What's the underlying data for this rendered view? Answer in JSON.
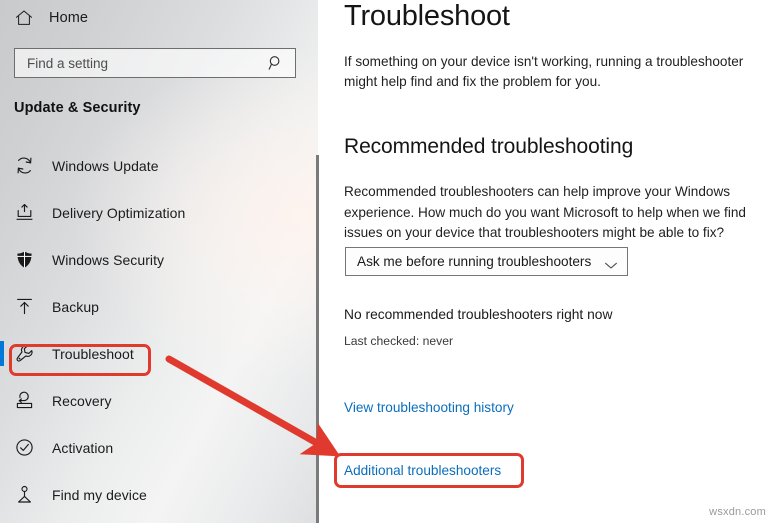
{
  "sidebar": {
    "home": {
      "label": "Home",
      "icon": "home-icon"
    },
    "search": {
      "placeholder": "Find a setting",
      "value": "",
      "icon": "search-icon"
    },
    "section_title": "Update & Security",
    "items": [
      {
        "label": "Windows Update",
        "icon": "refresh-icon",
        "selected": false
      },
      {
        "label": "Delivery Optimization",
        "icon": "upload-box-icon",
        "selected": false
      },
      {
        "label": "Windows Security",
        "icon": "shield-icon",
        "selected": false
      },
      {
        "label": "Backup",
        "icon": "upload-arrow-icon",
        "selected": false
      },
      {
        "label": "Troubleshoot",
        "icon": "wrench-icon",
        "selected": true
      },
      {
        "label": "Recovery",
        "icon": "recovery-icon",
        "selected": false
      },
      {
        "label": "Activation",
        "icon": "check-circle-icon",
        "selected": false
      },
      {
        "label": "Find my device",
        "icon": "person-locator-icon",
        "selected": false
      }
    ]
  },
  "main": {
    "title": "Troubleshoot",
    "intro": "If something on your device isn't working, running a troubleshooter might help find and fix the problem for you.",
    "recommended": {
      "heading": "Recommended troubleshooting",
      "description": "Recommended troubleshooters can help improve your Windows experience. How much do you want Microsoft to help when we find issues on your device that troubleshooters might be able to fix?",
      "dropdown": {
        "selected": "Ask me before running troubleshooters",
        "icon": "chevron-down-icon"
      },
      "status": "No recommended troubleshooters right now",
      "last_checked": "Last checked: never"
    },
    "links": {
      "history": "View troubleshooting history",
      "additional": "Additional troubleshooters"
    }
  },
  "annotations": {
    "highlight_color": "#e03a2f",
    "accent_color": "#0078d7",
    "link_color": "#0a6ebd"
  },
  "watermark": "wsxdn.com"
}
